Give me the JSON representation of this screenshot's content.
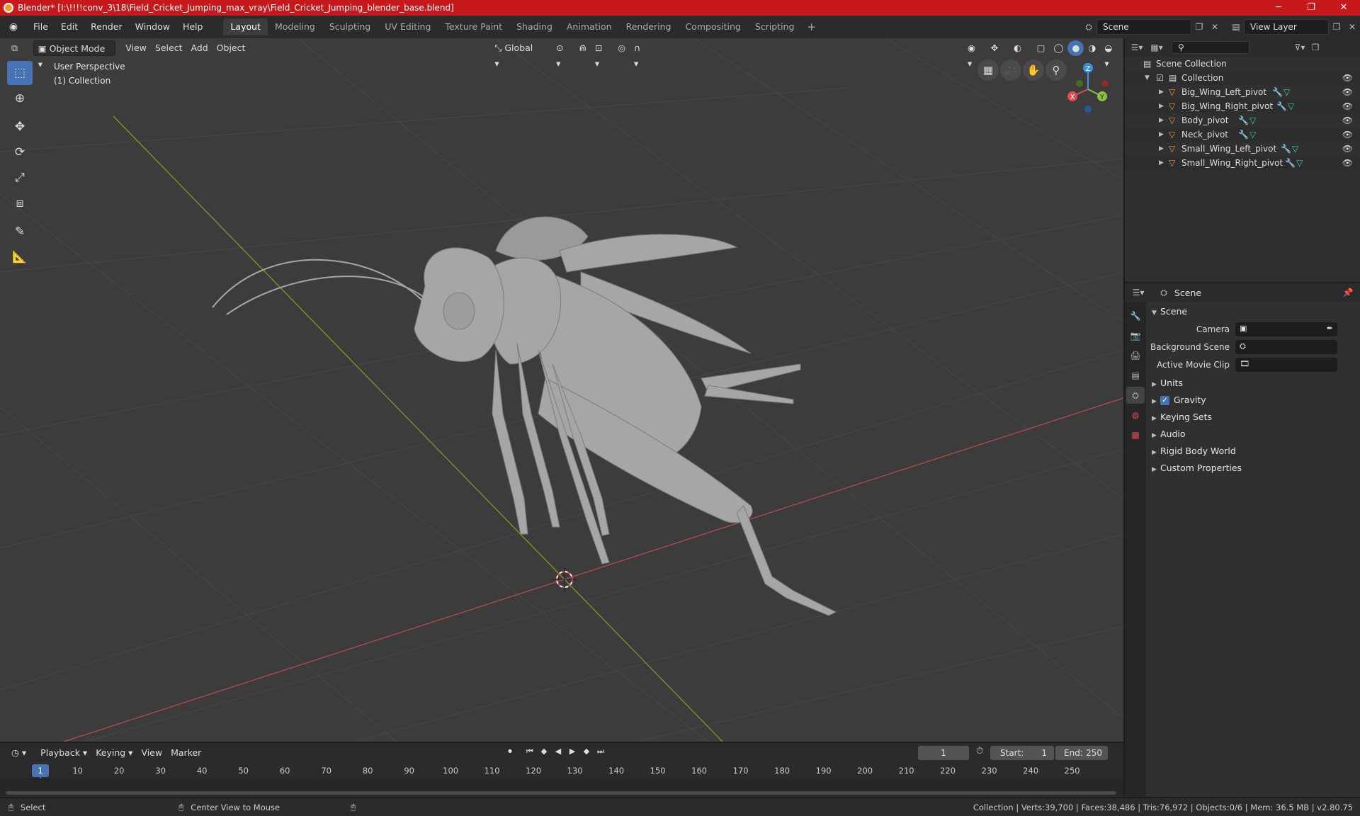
{
  "window": {
    "title": "Blender* [I:\\!!!!conv_3\\18\\Field_Cricket_Jumping_max_vray\\Field_Cricket_Jumping_blender_base.blend]",
    "minimize": "─",
    "maximize": "❐",
    "close": "✕"
  },
  "menu": [
    "File",
    "Edit",
    "Render",
    "Window",
    "Help"
  ],
  "workspaces": [
    "Layout",
    "Modeling",
    "Sculpting",
    "UV Editing",
    "Texture Paint",
    "Shading",
    "Animation",
    "Rendering",
    "Compositing",
    "Scripting"
  ],
  "workspace_add": "+",
  "scene_selector": "Scene",
  "view_layer_selector": "View Layer",
  "viewport": {
    "mode": "Object Mode",
    "menus": [
      "View",
      "Select",
      "Add",
      "Object"
    ],
    "transform_orientation": "Global",
    "perspective_label": "User Perspective",
    "collection_label": "(1) Collection",
    "gizmo": {
      "x": "X",
      "y": "Y",
      "z": "Z"
    }
  },
  "outliner": {
    "root": "Scene Collection",
    "collection": "Collection",
    "objects": [
      "Big_Wing_Left_pivot",
      "Big_Wing_Right_pivot",
      "Body_pivot",
      "Neck_pivot",
      "Small_Wing_Left_pivot",
      "Small_Wing_Right_pivot"
    ]
  },
  "properties": {
    "header": "Scene",
    "panel_title": "Scene",
    "fields": [
      {
        "label": "Camera"
      },
      {
        "label": "Background Scene"
      },
      {
        "label": "Active Movie Clip"
      }
    ],
    "subpanels": [
      "Units",
      "Gravity",
      "Keying Sets",
      "Audio",
      "Rigid Body World",
      "Custom Properties"
    ],
    "gravity_checked": true
  },
  "timeline": {
    "menus": [
      "Playback",
      "Keying",
      "View",
      "Marker"
    ],
    "current_frame": "1",
    "start_label": "Start:",
    "start": "1",
    "end_label": "End:",
    "end": "250",
    "ticks": [
      "1",
      "10",
      "20",
      "30",
      "40",
      "50",
      "60",
      "70",
      "80",
      "90",
      "100",
      "110",
      "120",
      "130",
      "140",
      "150",
      "160",
      "170",
      "180",
      "190",
      "200",
      "210",
      "220",
      "230",
      "240",
      "250"
    ]
  },
  "status": {
    "select": "Select",
    "center_view": "Center View to Mouse",
    "stats": "Collection | Verts:39,700 | Faces:38,486 | Tris:76,972 | Objects:0/6 | Mem: 36.5 MB | v2.80.75"
  },
  "colors": {
    "accent": "#4772b3",
    "titlebar": "#c7181b",
    "x_axis": "#e04a56",
    "y_axis": "#8bc23c",
    "z_axis": "#3d8ee6",
    "mesh_icon": "#e89a3c",
    "modifier_icon": "#5fa3e8",
    "data_icon": "#3fc8b1"
  }
}
